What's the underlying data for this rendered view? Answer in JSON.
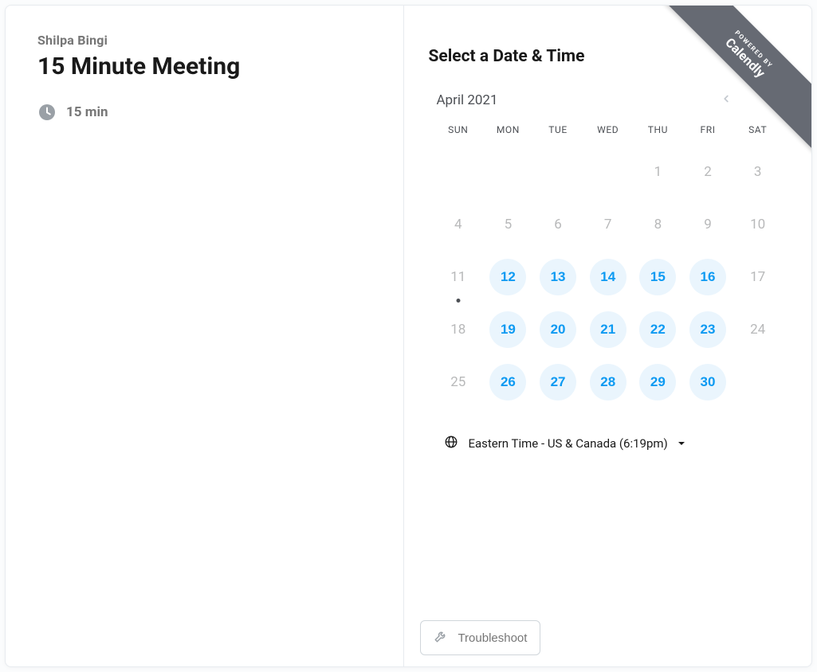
{
  "host": {
    "name": "Shilpa Bingi"
  },
  "event": {
    "title": "15 Minute Meeting",
    "duration_label": "15 min"
  },
  "heading": "Select a Date & Time",
  "month": {
    "label": "April 2021"
  },
  "weekdays": [
    "SUN",
    "MON",
    "TUE",
    "WED",
    "THU",
    "FRI",
    "SAT"
  ],
  "calendar_rows": [
    [
      {
        "n": ""
      },
      {
        "n": ""
      },
      {
        "n": ""
      },
      {
        "n": ""
      },
      {
        "n": "1"
      },
      {
        "n": "2"
      },
      {
        "n": "3"
      }
    ],
    [
      {
        "n": "4"
      },
      {
        "n": "5"
      },
      {
        "n": "6"
      },
      {
        "n": "7"
      },
      {
        "n": "8"
      },
      {
        "n": "9"
      },
      {
        "n": "10"
      }
    ],
    [
      {
        "n": "11",
        "today": true
      },
      {
        "n": "12",
        "available": true
      },
      {
        "n": "13",
        "available": true
      },
      {
        "n": "14",
        "available": true
      },
      {
        "n": "15",
        "available": true
      },
      {
        "n": "16",
        "available": true
      },
      {
        "n": "17"
      }
    ],
    [
      {
        "n": "18"
      },
      {
        "n": "19",
        "available": true
      },
      {
        "n": "20",
        "available": true
      },
      {
        "n": "21",
        "available": true
      },
      {
        "n": "22",
        "available": true
      },
      {
        "n": "23",
        "available": true
      },
      {
        "n": "24"
      }
    ],
    [
      {
        "n": "25"
      },
      {
        "n": "26",
        "available": true
      },
      {
        "n": "27",
        "available": true
      },
      {
        "n": "28",
        "available": true
      },
      {
        "n": "29",
        "available": true
      },
      {
        "n": "30",
        "available": true
      },
      {
        "n": ""
      }
    ]
  ],
  "timezone": {
    "label": "Eastern Time - US & Canada (6:19pm)"
  },
  "troubleshoot": {
    "label": "Troubleshoot"
  },
  "ribbon": {
    "small": "POWERED BY",
    "big": "Calendly"
  }
}
